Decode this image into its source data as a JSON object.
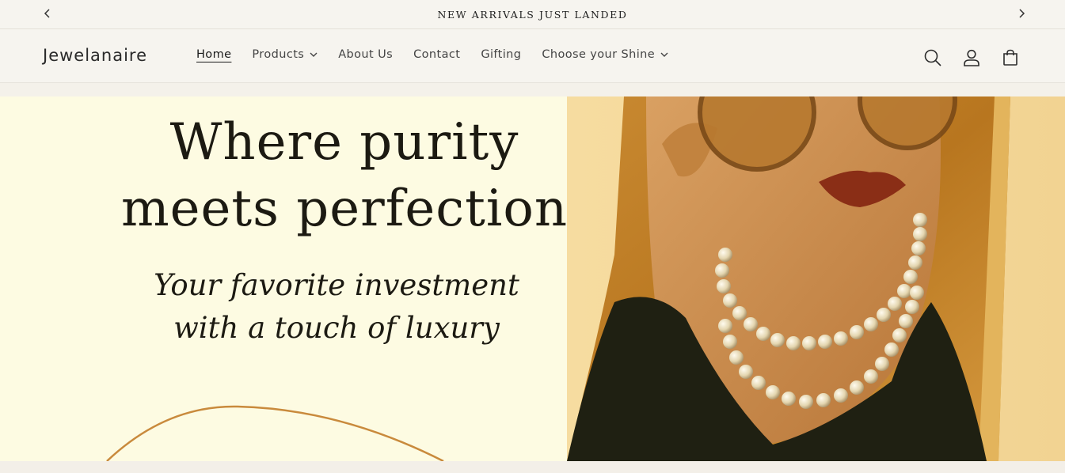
{
  "announcement": {
    "text": "NEW ARRIVALS JUST LANDED",
    "prev_icon": "chevron-left-icon",
    "next_icon": "chevron-right-icon"
  },
  "header": {
    "logo": "Jewelanaire",
    "nav": [
      {
        "label": "Home",
        "active": true
      },
      {
        "label": "Products",
        "dropdown": true
      },
      {
        "label": "About Us"
      },
      {
        "label": "Contact"
      },
      {
        "label": "Gifting"
      },
      {
        "label": "Choose your Shine",
        "dropdown": true
      }
    ],
    "icons": [
      "search-icon",
      "account-icon",
      "cart-icon"
    ]
  },
  "hero": {
    "title_line1": "Where purity",
    "title_line2": "meets perfection",
    "subtitle_line1": "Your favorite investment",
    "subtitle_line2": "with a touch of luxury"
  },
  "colors": {
    "hero_bg": "#fdfbe2",
    "accent_gold": "#c98a3c",
    "text_dark": "#1c1a12",
    "header_bg": "#f6f4ef"
  }
}
